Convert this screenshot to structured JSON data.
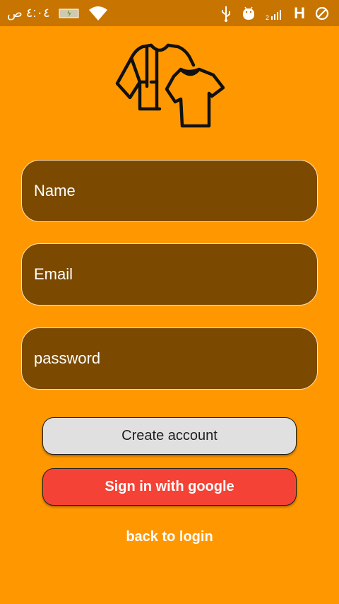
{
  "status_bar": {
    "time": "٤:٠٤ ص",
    "network_type": "H",
    "signal_label": "2",
    "icons": [
      "battery-icon",
      "wifi-icon",
      "usb-icon",
      "android-debug-icon",
      "signal-icon",
      "network-type",
      "blocked-icon"
    ]
  },
  "logo": {
    "icon": "clothing-icon"
  },
  "form": {
    "name_placeholder": "Name",
    "email_placeholder": "Email",
    "password_placeholder": "password"
  },
  "buttons": {
    "create_account": "Create account",
    "sign_in_google": "Sign in with google"
  },
  "links": {
    "back_to_login": "back to login"
  },
  "colors": {
    "background": "#FF9800",
    "status_bar": "#C77400",
    "field_fill": "#7B4A00",
    "field_border": "#FFE2B8",
    "create_button": "#E0E0E0",
    "google_button": "#F44336",
    "text_light": "#FFFFFF"
  }
}
